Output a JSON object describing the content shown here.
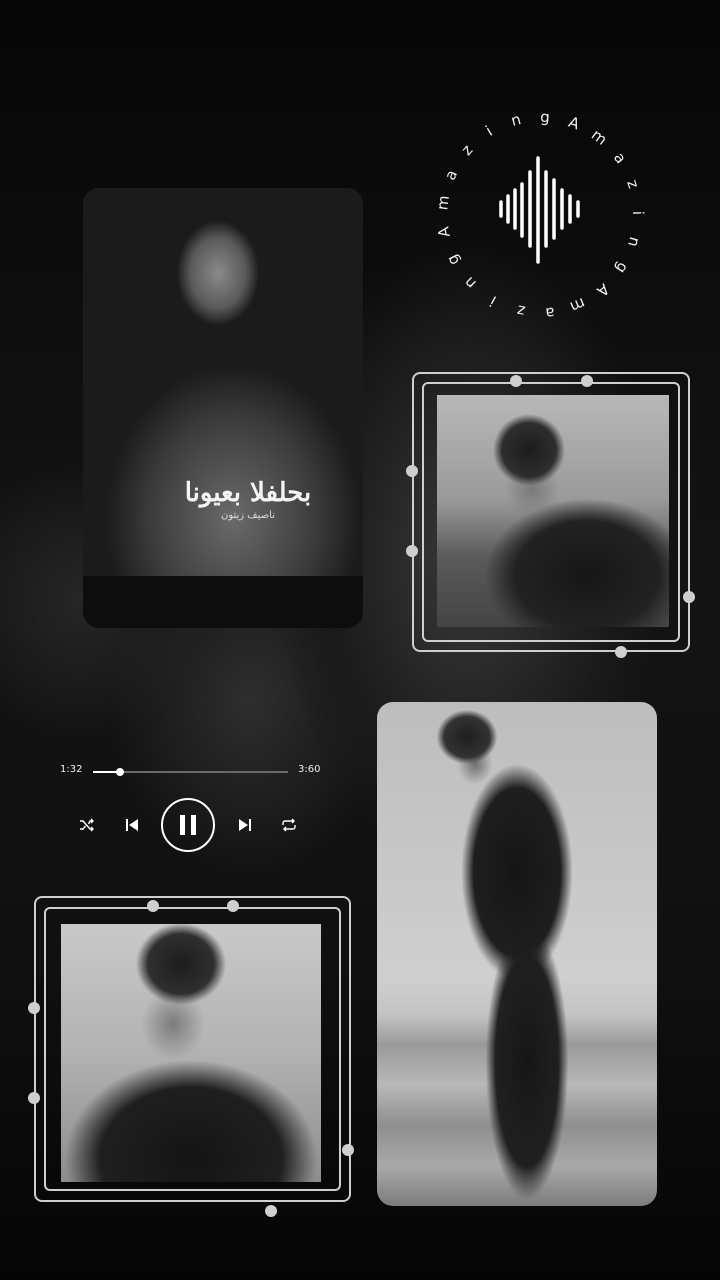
{
  "ring_text": "AmazingAmazingAmazing",
  "player": {
    "current_time": "1:32",
    "total_time": "3:60",
    "progress": 0.14
  },
  "card1": {
    "calligraphy": "بحلفلا بعيونا",
    "subtitle": "ناصيف زيتون"
  },
  "icons": {
    "waveform": "sound-wave-icon",
    "shuffle": "shuffle-icon",
    "previous": "previous-icon",
    "pause": "pause-icon",
    "next": "next-icon",
    "repeat": "repeat-icon"
  },
  "colors": {
    "background": "#0a0a0a",
    "accent": "#ffffff",
    "frame": "#cfcfcf"
  }
}
